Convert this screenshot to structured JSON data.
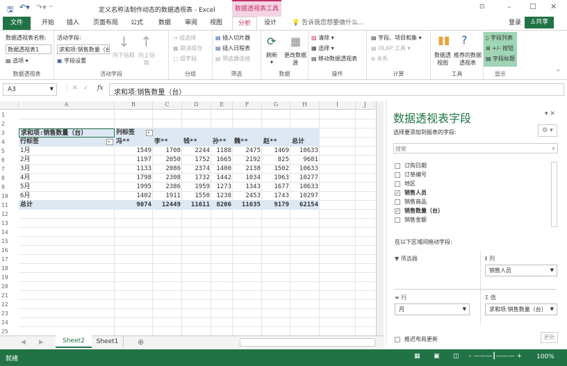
{
  "title": "定义名称法制作动态的数据透视表 - Excel",
  "context_tab": "数据透视表工具",
  "tabs": [
    "文件",
    "开始",
    "插入",
    "页面布局",
    "公式",
    "数据",
    "审阅",
    "视图",
    "分析",
    "设计"
  ],
  "tell_me": "告诉我您想要做什么...",
  "login": "登录",
  "share": "共享",
  "ribbon": {
    "pt_name_label": "数据透视表名称:",
    "pt_name": "数据透视表1",
    "options": "选项",
    "g1": "数据透视表",
    "active_field_label": "活动字段:",
    "active_field": "求和项:销售数量（台",
    "field_settings": "字段设置",
    "drill_down": "向下钻取",
    "drill_up": "向上钻取",
    "g2": "活动字段",
    "group_sel": "组选择",
    "ungroup": "取消组合",
    "group_field": "组字段",
    "g3": "分组",
    "slicer": "插入切片器",
    "timeline": "插入日程表",
    "filter_conn": "筛选器连接",
    "g4": "筛选",
    "refresh": "刷新",
    "change_src": "更改数据源",
    "g5": "数据",
    "clear": "清除",
    "select": "选择",
    "move": "移动数据透视表",
    "g6": "操作",
    "fields_items": "字段、项目和集",
    "olap": "OLAP 工具",
    "relations": "关系",
    "g7": "计算",
    "pivotchart": "数据透视图",
    "recommended": "推荐的数据透视表",
    "g8": "工具",
    "field_list": "字段列表",
    "buttons": "+/- 按钮",
    "headers": "字段标题",
    "g9": "显示"
  },
  "formula": {
    "cell": "A3",
    "fx": "fx",
    "content": "求和项:销售数量（台）"
  },
  "columns": [
    "A",
    "B",
    "C",
    "D",
    "E",
    "F",
    "G",
    "H",
    "I",
    "J"
  ],
  "pivot": {
    "corner": "求和项:销售数量（台）",
    "col_label": "列标签",
    "row_label": "行标签",
    "headers": [
      "冯**",
      "李**",
      "钱**",
      "孙**",
      "魏**",
      "赵**",
      "总计"
    ],
    "rows": [
      {
        "label": "1月",
        "values": [
          1549,
          1708,
          2244,
          1188,
          2475,
          1469,
          10633
        ]
      },
      {
        "label": "2月",
        "values": [
          1197,
          2050,
          1752,
          1665,
          2192,
          825,
          9681
        ]
      },
      {
        "label": "3月",
        "values": [
          1133,
          2086,
          2374,
          1400,
          2138,
          1502,
          10633
        ]
      },
      {
        "label": "4月",
        "values": [
          1798,
          2308,
          1732,
          1442,
          1034,
          1963,
          10277
        ]
      },
      {
        "label": "5月",
        "values": [
          1995,
          2386,
          1959,
          1273,
          1343,
          1677,
          10633
        ]
      },
      {
        "label": "6月",
        "values": [
          1402,
          1911,
          1550,
          1238,
          2453,
          1743,
          10297
        ]
      }
    ],
    "total": {
      "label": "总计",
      "values": [
        9074,
        12449,
        11611,
        8206,
        11635,
        9179,
        62154
      ]
    }
  },
  "sheets": [
    "Sheet2",
    "Sheet1"
  ],
  "status": {
    "ready": "就绪",
    "zoom": "100%"
  },
  "pane": {
    "title": "数据透视表字段",
    "choose": "选择要添加到报表的字段:",
    "search": "搜索",
    "fields": [
      {
        "name": "订购日期",
        "checked": false
      },
      {
        "name": "订单编号",
        "checked": false
      },
      {
        "name": "地区",
        "checked": false
      },
      {
        "name": "销售人员",
        "checked": true
      },
      {
        "name": "销售商品",
        "checked": false
      },
      {
        "name": "销售数量（台）",
        "checked": true
      },
      {
        "name": "销售金额",
        "checked": false
      }
    ],
    "drag": "在以下区域间拖动字段:",
    "filters": "筛选器",
    "columns": "列",
    "rows": "行",
    "values": "值",
    "col_item": "销售人员",
    "row_item": "月",
    "val_item": "求和项:销售数量（台）",
    "defer": "推迟布局更新",
    "update": "更新"
  }
}
